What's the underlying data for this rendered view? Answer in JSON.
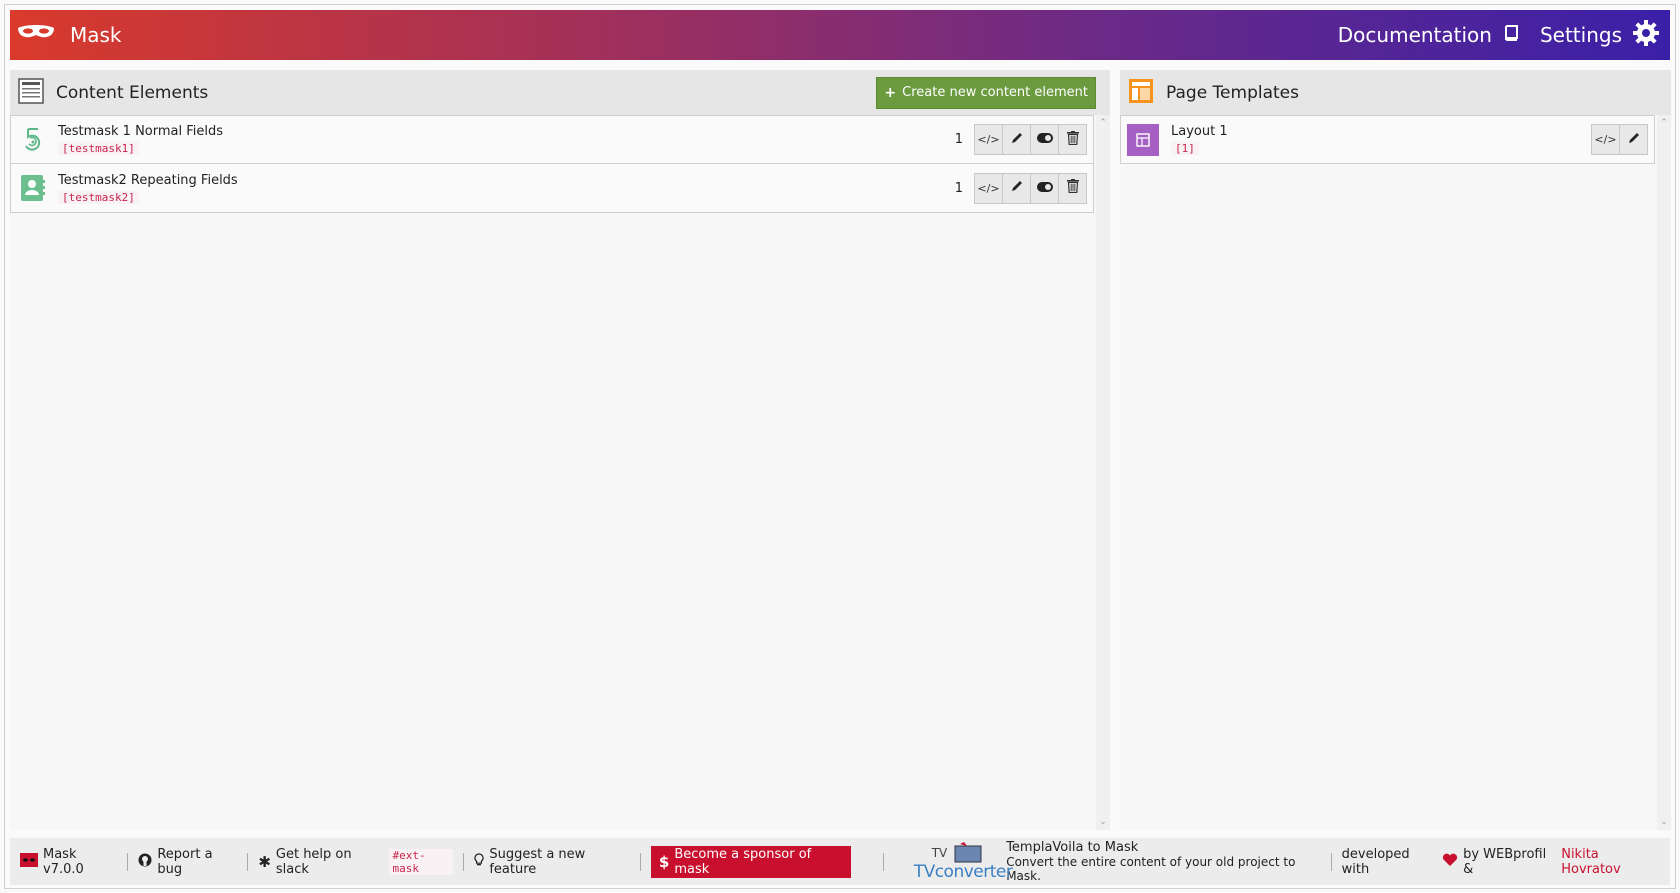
{
  "header": {
    "brand": "Mask",
    "documentation_label": "Documentation",
    "settings_label": "Settings",
    "gradient_colors": [
      "#d93a2b",
      "#6c2a86",
      "#3a20a8"
    ]
  },
  "content_elements": {
    "title": "Content Elements",
    "create_button_label": "Create new content element",
    "items": [
      {
        "title": "Testmask 1 Normal Fields",
        "key": "[testmask1]",
        "count": "1",
        "icon": "fingerprint-five-icon"
      },
      {
        "title": "Testmask2 Repeating Fields",
        "key": "[testmask2]",
        "count": "1",
        "icon": "contact-card-icon"
      }
    ]
  },
  "page_templates": {
    "title": "Page Templates",
    "items": [
      {
        "title": "Layout 1",
        "key": "[1]",
        "icon": "layout-icon"
      }
    ]
  },
  "footer": {
    "version": "Mask v7.0.0",
    "report_bug": "Report a bug",
    "slack_help": "Get help on slack",
    "slack_channel": "#ext-mask",
    "suggest_feature": "Suggest a new feature",
    "sponsor": "Become a sponsor of mask",
    "tv_title": "TemplaVoila to Mask",
    "tv_subtitle": "Convert the entire content of your old project to Mask.",
    "tv_logo_text_top": "TV",
    "tv_logo_text_main": "TVconverter",
    "developed_with": "developed with",
    "by": "by WEBprofil &",
    "author": "Nikita Hovratov",
    "sponsor_color": "#c8102e",
    "create_color": "#6b9a3f"
  }
}
